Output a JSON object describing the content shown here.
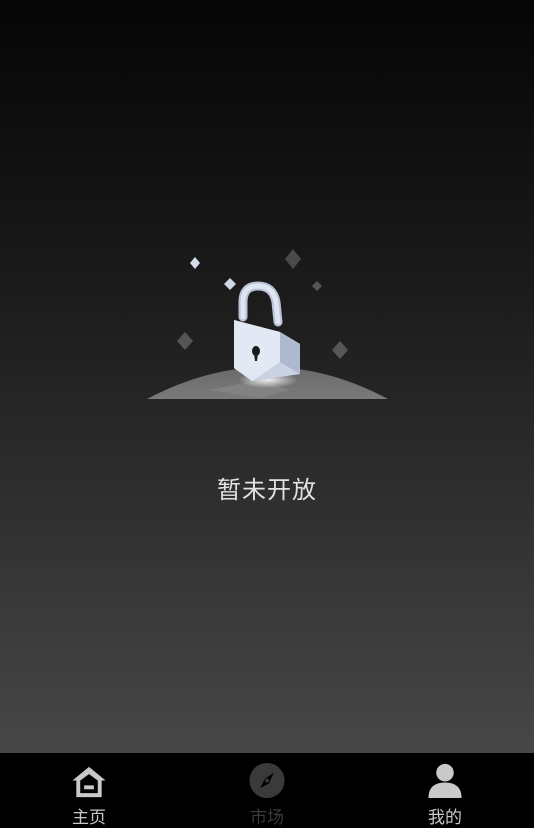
{
  "empty_state": {
    "illustration_icon": "lock-icon",
    "message": "暂未开放"
  },
  "tabbar": {
    "items": [
      {
        "label": "主页",
        "icon": "home-icon",
        "color": "#c9c9c9",
        "state": "normal"
      },
      {
        "label": "市场",
        "icon": "compass-icon",
        "color": "#3a3a3a",
        "state": "dimmed"
      },
      {
        "label": "我的",
        "icon": "user-icon",
        "color": "#c9c9c9",
        "state": "normal"
      }
    ]
  },
  "colors": {
    "tabbar_bg": "#000000",
    "gradient_top": "#050505",
    "gradient_bottom": "#474747",
    "lock": "#dde5f2"
  }
}
